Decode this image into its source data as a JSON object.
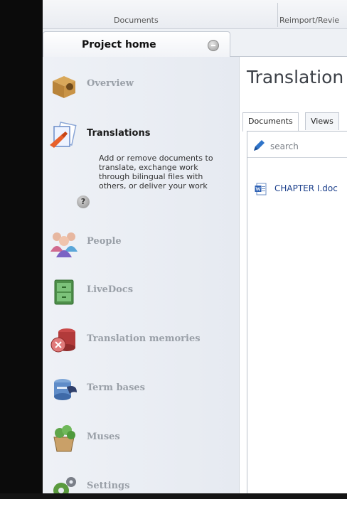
{
  "ribbon": {
    "group_documents": "Documents",
    "group_reimport": "Reimport/Revie"
  },
  "tabs": {
    "project_home": "Project home"
  },
  "sidebar": {
    "items": [
      {
        "label": "Overview",
        "icon": "overview-icon"
      },
      {
        "label": "Translations",
        "icon": "translations-icon",
        "active": true,
        "description": "Add or remove documents to translate, exchange work through bilingual files with others, or deliver your work"
      },
      {
        "label": "People",
        "icon": "people-icon"
      },
      {
        "label": "LiveDocs",
        "icon": "livedocs-icon"
      },
      {
        "label": "Translation memories",
        "icon": "translation-memories-icon"
      },
      {
        "label": "Term bases",
        "icon": "term-bases-icon"
      },
      {
        "label": "Muses",
        "icon": "muses-icon"
      },
      {
        "label": "Settings",
        "icon": "settings-icon"
      }
    ],
    "help_glyph": "?"
  },
  "main": {
    "title": "Translation",
    "subtabs": [
      "Documents",
      "Views"
    ],
    "search": {
      "placeholder": "search",
      "value": ""
    },
    "files": [
      {
        "name": "CHAPTER I.doc",
        "icon": "word-doc-icon"
      }
    ]
  },
  "colors": {
    "nav_bg": "#eef1f6",
    "inactive_label": "#9aa0a8",
    "link_blue": "#1b3f8b"
  }
}
